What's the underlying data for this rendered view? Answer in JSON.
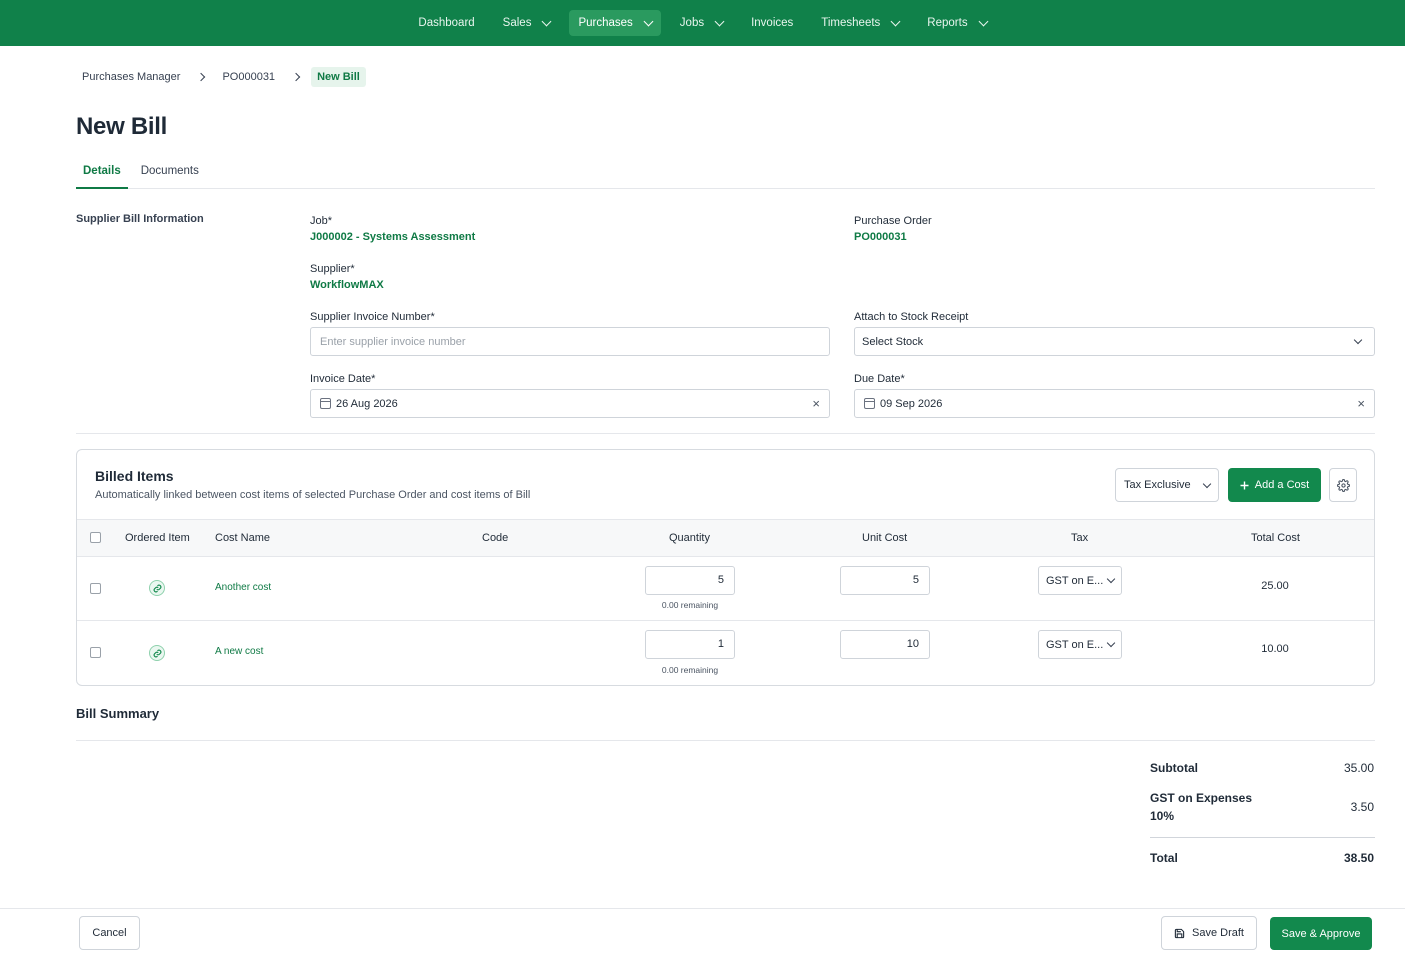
{
  "nav": {
    "items": [
      {
        "label": "Dashboard",
        "dropdown": false,
        "active": false
      },
      {
        "label": "Sales",
        "dropdown": true,
        "active": false
      },
      {
        "label": "Purchases",
        "dropdown": true,
        "active": true
      },
      {
        "label": "Jobs",
        "dropdown": true,
        "active": false
      },
      {
        "label": "Invoices",
        "dropdown": false,
        "active": false
      },
      {
        "label": "Timesheets",
        "dropdown": true,
        "active": false
      },
      {
        "label": "Reports",
        "dropdown": true,
        "active": false
      }
    ]
  },
  "breadcrumb": {
    "items": [
      "Purchases Manager",
      "PO000031"
    ],
    "current": "New Bill"
  },
  "page": {
    "title": "New Bill"
  },
  "tabs": [
    {
      "label": "Details",
      "active": true
    },
    {
      "label": "Documents",
      "active": false
    }
  ],
  "form": {
    "section_label": "Supplier Bill Information",
    "job_label": "Job*",
    "job_value": "J000002 - Systems Assessment",
    "po_label": "Purchase Order",
    "po_value": "PO000031",
    "supplier_label": "Supplier*",
    "supplier_value": "WorkflowMAX",
    "invoice_number_label": "Supplier Invoice Number*",
    "invoice_number_placeholder": "Enter supplier invoice number",
    "stock_label": "Attach to Stock Receipt",
    "stock_value": "Select Stock",
    "invoice_date_label": "Invoice Date*",
    "invoice_date_value": "26 Aug 2026",
    "due_date_label": "Due Date*",
    "due_date_value": "09 Sep 2026",
    "clear_glyph": "×"
  },
  "billed_items": {
    "title": "Billed Items",
    "subtitle": "Automatically linked between cost items of selected Purchase Order and cost items of Bill",
    "tax_mode": "Tax Exclusive",
    "add_label": "Add a Cost",
    "columns": [
      "Ordered Item",
      "Cost Name",
      "Code",
      "Quantity",
      "Unit Cost",
      "Tax",
      "Total Cost"
    ],
    "rows": [
      {
        "cost_name": "Another cost",
        "code": "",
        "quantity": "5",
        "remaining": "0.00 remaining",
        "unit_cost": "5",
        "tax": "GST on E...",
        "total": "25.00"
      },
      {
        "cost_name": "A new cost",
        "code": "",
        "quantity": "1",
        "remaining": "0.00 remaining",
        "unit_cost": "10",
        "tax": "GST on E...",
        "total": "10.00"
      }
    ]
  },
  "summary": {
    "title": "Bill Summary",
    "subtotal_label": "Subtotal",
    "subtotal_value": "35.00",
    "gst_label_line1": "GST on Expenses",
    "gst_label_line2": "10%",
    "gst_value": "3.50",
    "total_label": "Total",
    "total_value": "38.50"
  },
  "footer": {
    "cancel_label": "Cancel",
    "save_draft_label": "Save Draft",
    "save_approve_label": "Save & Approve"
  },
  "colors": {
    "brand": "#10814a",
    "accent": "#0f7a45",
    "button": "#12894d"
  }
}
